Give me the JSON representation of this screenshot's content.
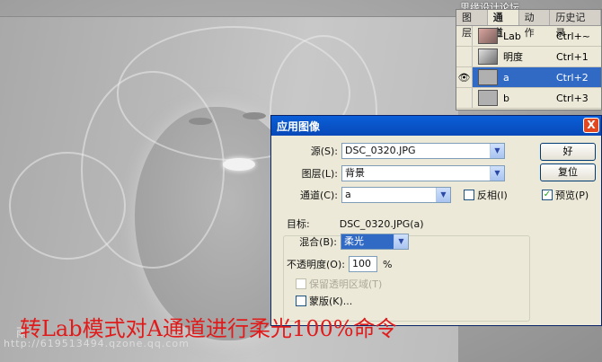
{
  "watermark_top": "思缘设计论坛 www.missyuan.com",
  "watermark_bottom": "http://619513494.qzone.qq.com",
  "watermark_logo": "雨",
  "channels_panel": {
    "tabs": [
      "图层",
      "通道",
      "动作",
      "历史记录"
    ],
    "channels": [
      {
        "name": "Lab",
        "shortcut": "Ctrl+~",
        "thumb": "color",
        "visible": false,
        "selected": false
      },
      {
        "name": "明度",
        "shortcut": "Ctrl+1",
        "thumb": "light",
        "visible": false,
        "selected": false
      },
      {
        "name": "a",
        "shortcut": "Ctrl+2",
        "thumb": "gray",
        "visible": true,
        "selected": true
      },
      {
        "name": "b",
        "shortcut": "Ctrl+3",
        "thumb": "gray",
        "visible": false,
        "selected": false
      }
    ]
  },
  "dialog": {
    "title": "应用图像",
    "close": "X",
    "source_label": "源(S):",
    "source_value": "DSC_0320.JPG",
    "layer_label": "图层(L):",
    "layer_value": "背景",
    "channel_label": "通道(C):",
    "channel_value": "a",
    "invert_label": "反相(I)",
    "target_label": "目标:",
    "target_value": "DSC_0320.JPG(a)",
    "blend_label": "混合(B):",
    "blend_value": "柔光",
    "opacity_label": "不透明度(O):",
    "opacity_value": "100",
    "opacity_unit": "%",
    "preserve_label": "保留透明区域(T)",
    "mask_label": "蒙版(K)...",
    "ok_label": "好",
    "reset_label": "复位",
    "preview_label": "预览(P)",
    "preview_checked": "✓"
  },
  "caption": "转Lab模式对A通道进行柔光100%命令",
  "colors": {
    "caption": "#e01b1b",
    "selection": "#316ac5",
    "titlebar": "#0a5fd8"
  }
}
